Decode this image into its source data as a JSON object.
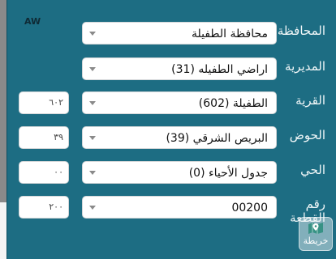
{
  "logo": {
    "text": "AW",
    "icon": "brand-logo-icon"
  },
  "fields": {
    "governorate": {
      "label": "المحافظة",
      "value": "محافظة الطفيلة"
    },
    "directorate": {
      "label": "المديرية",
      "value": "اراضي الطفيله (31)"
    },
    "village": {
      "label": "القرية",
      "value": "الطفيلة (602)",
      "code": "٦٠٢"
    },
    "basin": {
      "label": "الحوض",
      "value": "البريص الشرقي (39)",
      "code": "٣٩"
    },
    "neighborhood": {
      "label": "الحي",
      "value": "جدول الأحياء (0)",
      "code": "٠٠"
    },
    "plot": {
      "label_line1": "رقم",
      "label_line2": "القطعة",
      "value": "00200",
      "code": "٢٠٠"
    }
  },
  "map_button": {
    "label": "خريطة",
    "icon": "map-pin-icon"
  },
  "colors": {
    "panel": "#1d6d83",
    "field_bg": "#ffffff",
    "label_text": "#f1f7f8"
  }
}
